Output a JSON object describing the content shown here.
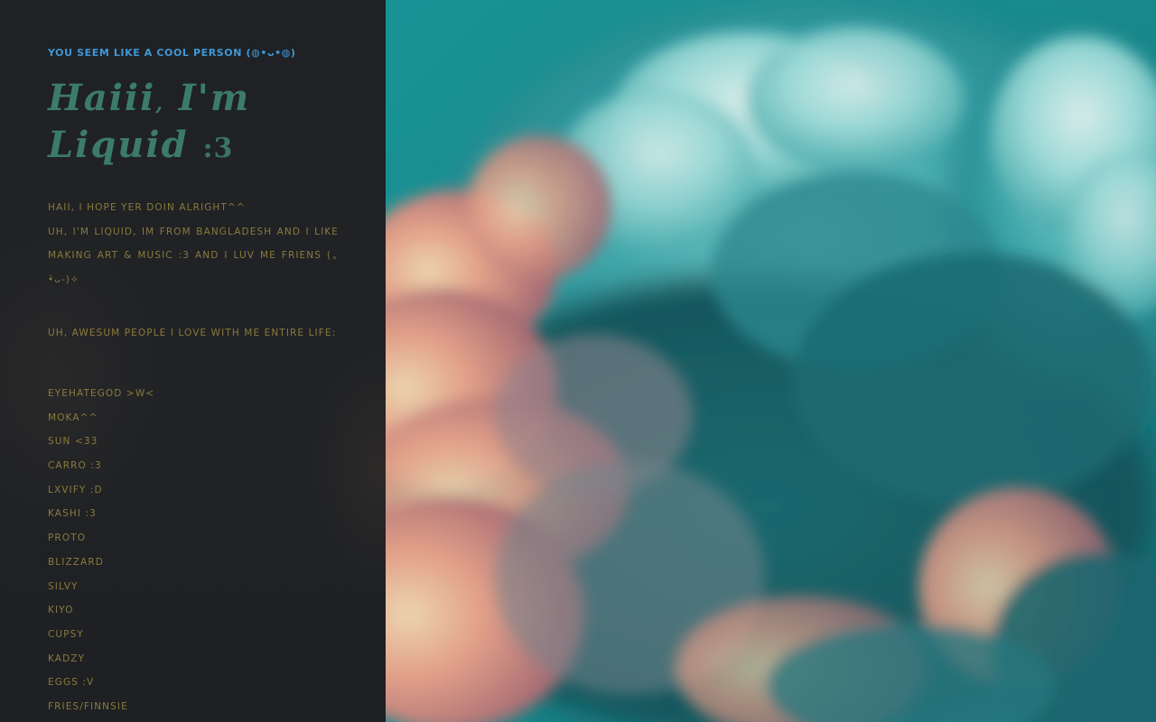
{
  "sidebar": {
    "tagline": "YOU SEEM LIKE A COOL PERSON (◍•ᴗ•◍)",
    "title": {
      "line1_word1": "Haiii",
      "line1_comma": ",",
      "line1_word2": "I'm",
      "line2_word1": "Liquid",
      "line2_emote": ":3"
    },
    "intro": [
      "HAII, I HOPE YER DOIN ALRIGHT^^",
      "UH, I'M LIQUID, IM FROM BANGLADESH AND I LIKE MAKING ART & MUSIC :3 AND I LUV ME FRIENS (｡•̀ᴗ-)✧"
    ],
    "friends_heading": "UH, AWESUM PEOPLE I LOVE WITH ME ENTIRE LIFE:",
    "friends": [
      "EYEHATEGOD >W<",
      "MOKA^^",
      "SUN <33",
      "CARRO :3",
      "LXVIFY :D",
      "KASHI :3",
      "PROTO",
      "BLIZZARD",
      "SILVY",
      "KIYO",
      "CUPSY",
      "KADZY",
      "EGGS :V",
      "FRIES/FINNSIE"
    ]
  },
  "hero": {
    "image": "cloud-sky-image"
  },
  "colors": {
    "sidebar_bg": "#202225",
    "tagline": "#3f97d6",
    "title": "#3c7b6c",
    "body_text": "#8a7a3c",
    "sky_teal": "#1f9ea0",
    "cloud_pink": "#f0a08a"
  }
}
